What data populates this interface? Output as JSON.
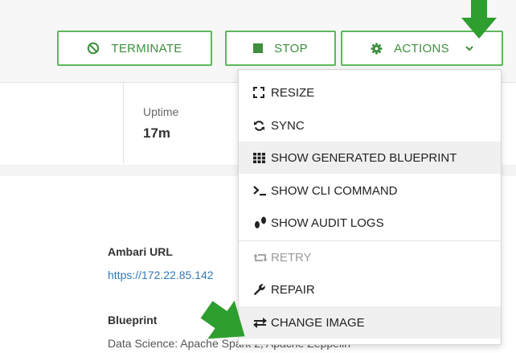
{
  "toolbar": {
    "terminate_label": "TERMINATE",
    "stop_label": "STOP",
    "actions_label": "ACTIONS"
  },
  "stats": {
    "uptime_label": "Uptime",
    "uptime_value": "17m"
  },
  "details": {
    "ambari_label": "Ambari URL",
    "ambari_url": "https://172.22.85.142",
    "blueprint_label": "Blueprint",
    "blueprint_value": "Data Science: Apache Spark 2, Apache Zeppelin"
  },
  "menu": {
    "items": [
      {
        "label": "RESIZE",
        "icon": "resize-icon"
      },
      {
        "label": "SYNC",
        "icon": "sync-icon"
      },
      {
        "label": "SHOW GENERATED BLUEPRINT",
        "icon": "grid-icon"
      },
      {
        "label": "SHOW CLI COMMAND",
        "icon": "terminal-icon"
      },
      {
        "label": "SHOW AUDIT LOGS",
        "icon": "footprints-icon"
      },
      {
        "label": "RETRY",
        "icon": "retry-icon"
      },
      {
        "label": "REPAIR",
        "icon": "wrench-icon"
      },
      {
        "label": "CHANGE IMAGE",
        "icon": "exchange-icon"
      }
    ]
  },
  "colors": {
    "accent": "#5cb85c",
    "accent_text": "#3e8f3e",
    "link": "#337ab7",
    "annotation_arrow": "#2e9e2e"
  }
}
